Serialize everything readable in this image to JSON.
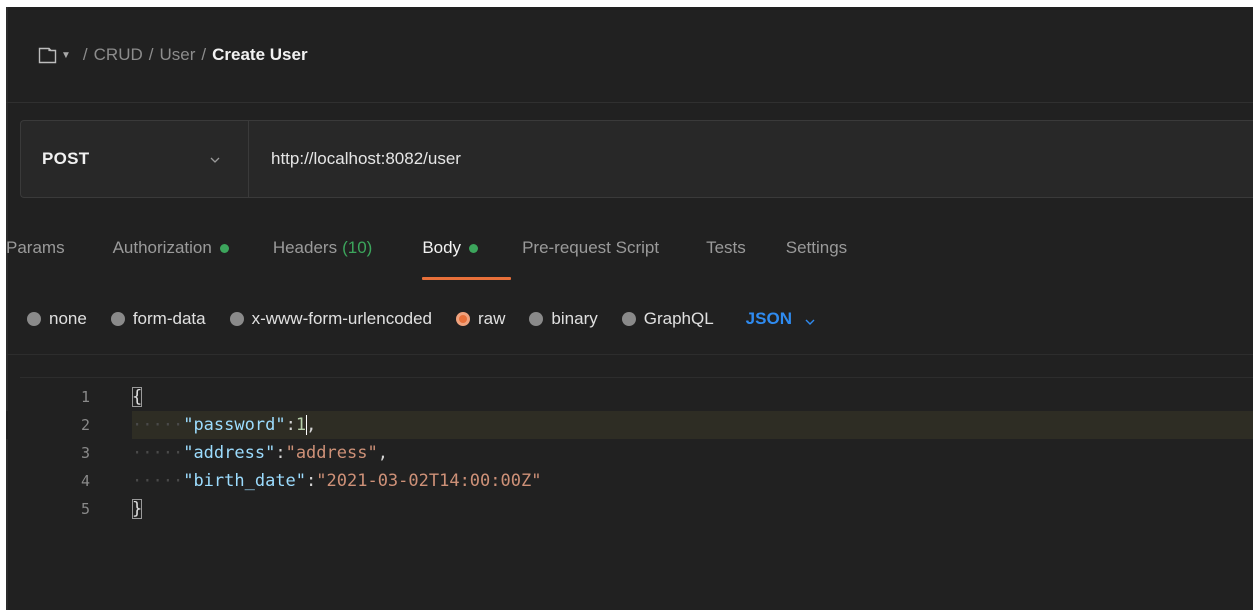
{
  "breadcrumb": {
    "items": [
      "CRUD",
      "User"
    ],
    "current": "Create User",
    "separator": "/"
  },
  "request": {
    "method": "POST",
    "url": "http://localhost:8082/user"
  },
  "tabs": [
    {
      "label": "Params"
    },
    {
      "label": "Authorization",
      "dot_color": "#3ca55c"
    },
    {
      "label": "Headers",
      "count": "(10)"
    },
    {
      "label": "Body",
      "dot_color": "#3ca55c",
      "active": true
    },
    {
      "label": "Pre-request Script"
    },
    {
      "label": "Tests"
    },
    {
      "label": "Settings"
    }
  ],
  "body_types": {
    "options": [
      "none",
      "form-data",
      "x-www-form-urlencoded",
      "raw",
      "binary",
      "GraphQL"
    ],
    "selected": "raw",
    "format": "JSON"
  },
  "editor": {
    "line_numbers": [
      "1",
      "2",
      "3",
      "4",
      "5"
    ],
    "lines": [
      {
        "open_brace": "{"
      },
      {
        "key": "\"password\"",
        "colon": ":",
        "value": "1",
        "comma": ","
      },
      {
        "key": "\"address\"",
        "colon": ":",
        "value": "\"address\"",
        "comma": ","
      },
      {
        "key": "\"birth_date\"",
        "colon": ":",
        "value": "\"2021-03-02T14:00:00Z\""
      },
      {
        "close_brace": "}"
      }
    ]
  },
  "colors": {
    "accent": "#e8703a",
    "success": "#3ca55c",
    "link": "#2f8bf0",
    "background": "#212121"
  },
  "icons": {
    "collection": "collection-icon",
    "caret": "caret-down-icon",
    "chevron": "chevron-down-icon"
  }
}
